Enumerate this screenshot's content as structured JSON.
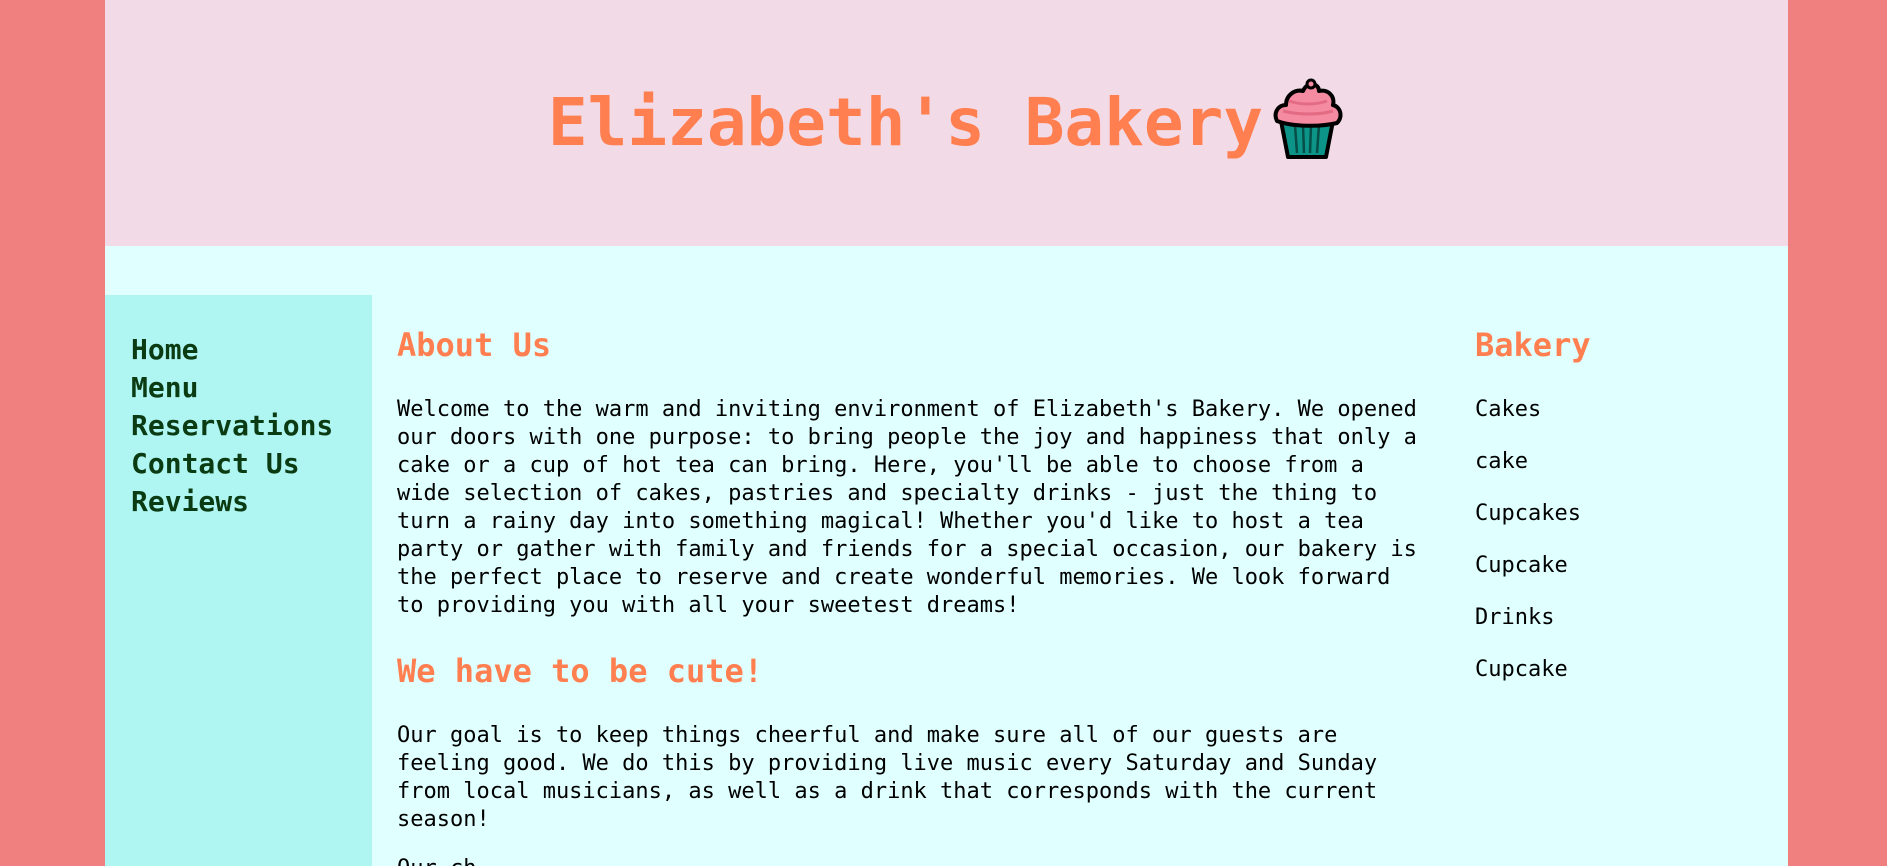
{
  "header": {
    "title": "Elizabeth's Bakery",
    "icon": "cupcake-icon"
  },
  "nav": {
    "items": [
      {
        "label": "Home"
      },
      {
        "label": "Menu"
      },
      {
        "label": "Reservations"
      },
      {
        "label": "Contact Us"
      },
      {
        "label": "Reviews"
      }
    ]
  },
  "main": {
    "about_title": "About Us",
    "about_text": "Welcome to the warm and inviting environment of Elizabeth's Bakery. We opened\nour doors with one purpose: to bring people the joy and happiness that only a\ncake or a cup of hot tea can bring. Here, you'll be able to choose from a\nwide selection of cakes, pastries and specialty drinks - just the thing to\nturn a rainy day into something magical! Whether you'd like to host a tea\nparty or gather with family and friends for a special occasion, our bakery is\nthe perfect place to reserve and create wonderful memories. We look forward\nto providing you with all your sweetest dreams!",
    "cute_title": "We have to be cute!",
    "cute_text": "Our goal is to keep things cheerful and make sure all of our guests are\nfeeling good. We do this by providing live music every Saturday and Sunday\nfrom local musicians, as well as a drink that corresponds with the current\nseason!",
    "extra_text": "Our ch"
  },
  "aside": {
    "title": "Bakery",
    "items": [
      {
        "label": "Cakes"
      },
      {
        "label": "cake"
      },
      {
        "label": "Cupcakes"
      },
      {
        "label": "Cupcake"
      },
      {
        "label": "Drinks"
      },
      {
        "label": "Cupcake"
      }
    ]
  },
  "colors": {
    "page_bg": "#f08080",
    "content_bg": "#e0ffff",
    "header_bg": "#f2dbe6",
    "nav_bg": "#aff5f2",
    "accent": "#ff7f50",
    "nav_text": "#0b3b12"
  }
}
